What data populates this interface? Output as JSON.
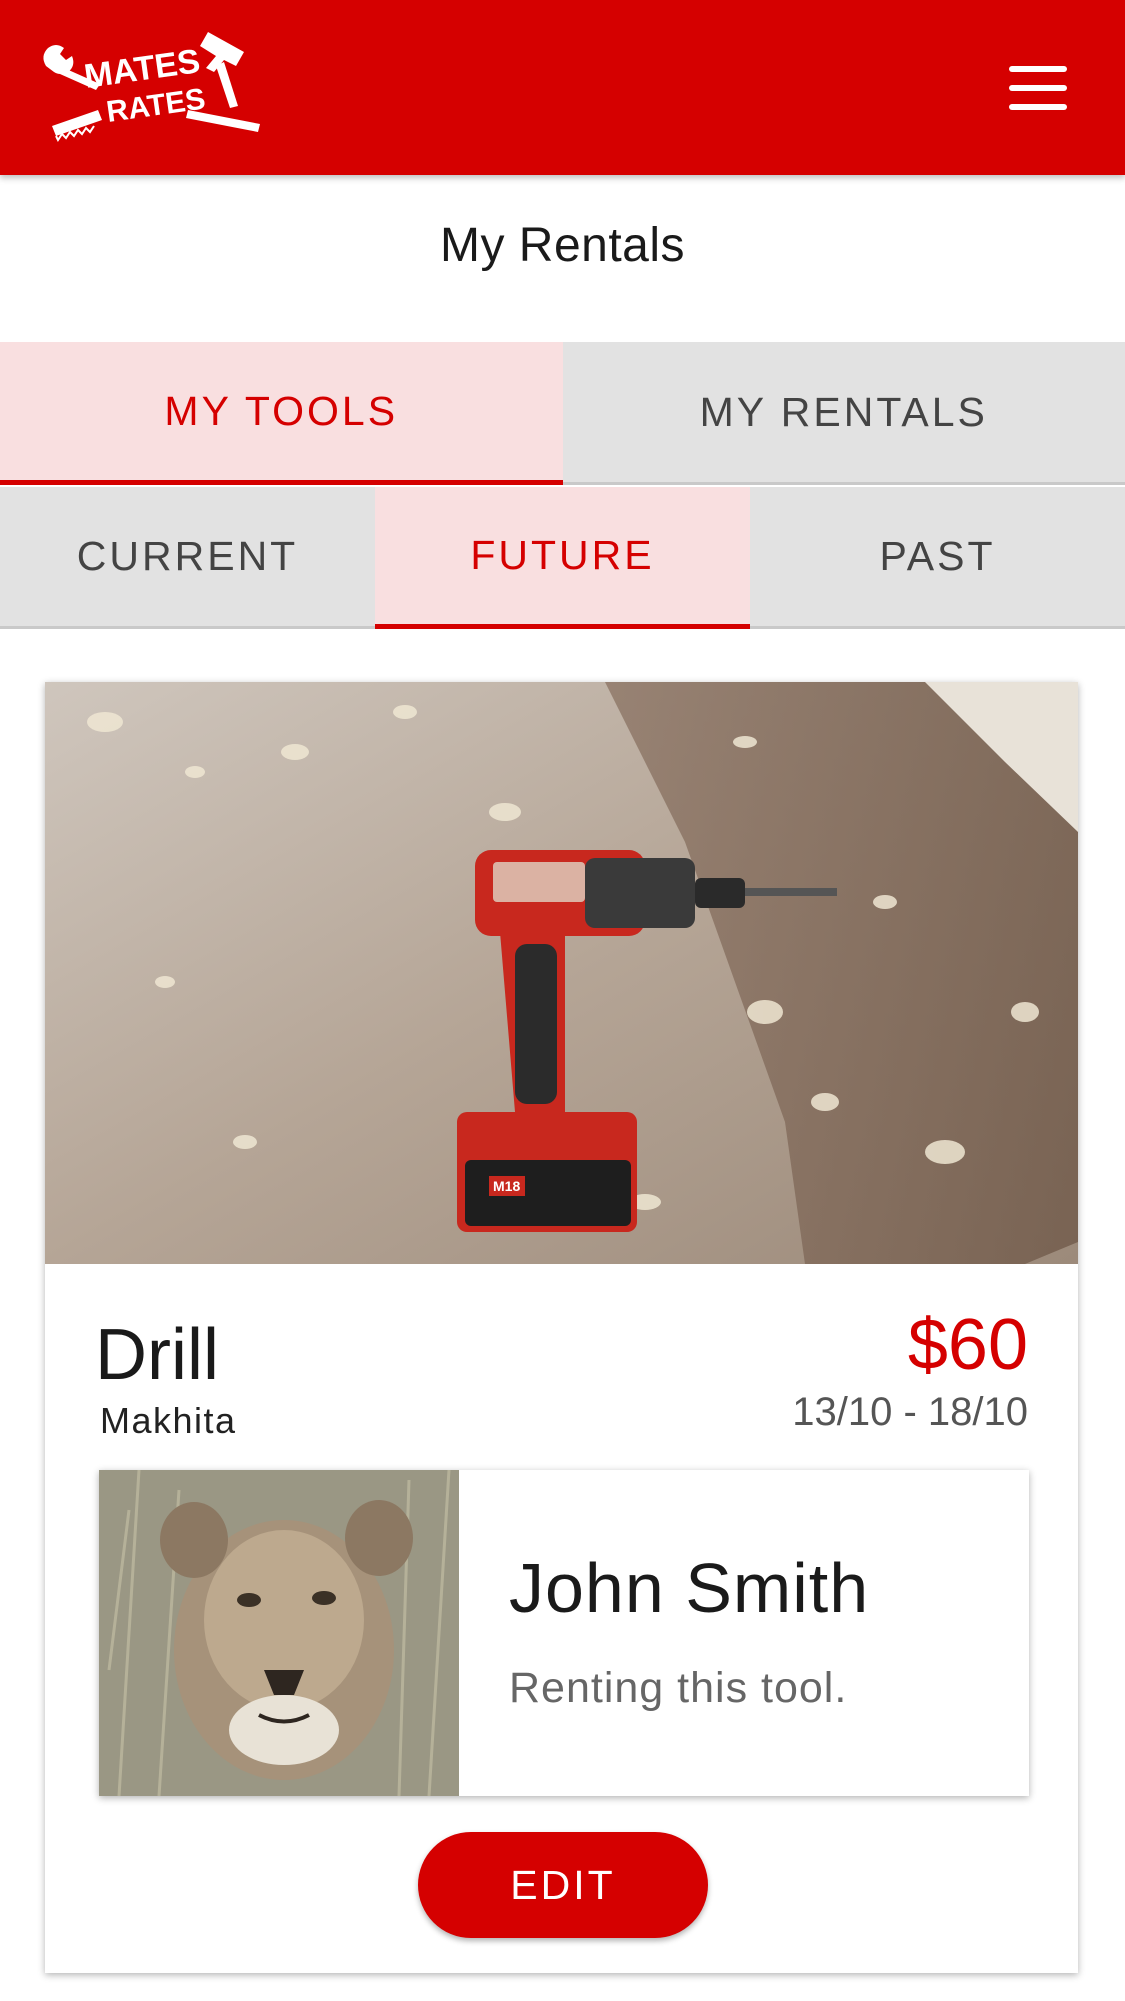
{
  "app": {
    "logo_line1": "MATES",
    "logo_line2": "RATES",
    "brand_color": "#d50000"
  },
  "page": {
    "title": "My Rentals"
  },
  "tabs_main": [
    {
      "label": "MY TOOLS",
      "active": true
    },
    {
      "label": "MY RENTALS",
      "active": false
    }
  ],
  "tabs_sub": [
    {
      "label": "CURRENT",
      "active": false
    },
    {
      "label": "FUTURE",
      "active": true
    },
    {
      "label": "PAST",
      "active": false
    }
  ],
  "rental": {
    "tool_name": "Drill",
    "brand": "Makhita",
    "price": "$60",
    "dates": "13/10 - 18/10",
    "battery_badge": "M18",
    "renter": {
      "name": "John Smith",
      "status": "Renting this tool."
    },
    "edit_label": "EDIT"
  },
  "icons": {
    "menu": "hamburger-menu-icon",
    "logo": "hammer-wrench-logo"
  }
}
